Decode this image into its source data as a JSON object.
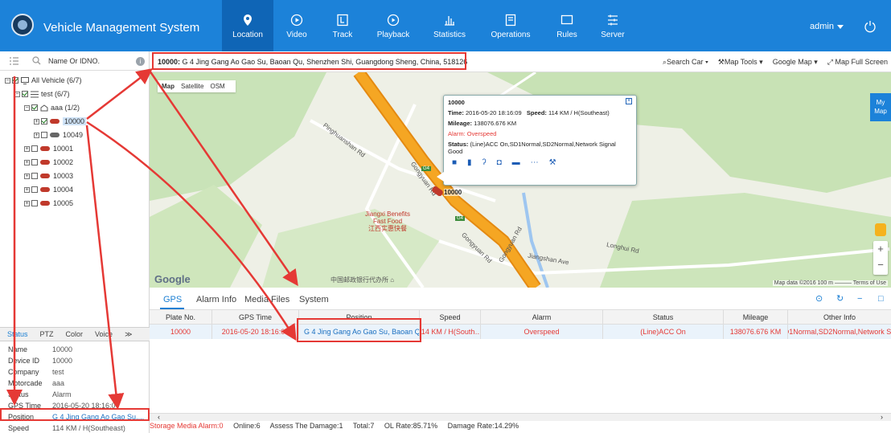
{
  "app": {
    "title": "Vehicle Management System",
    "nav": [
      {
        "label": "Location",
        "icon": "location-icon"
      },
      {
        "label": "Video",
        "icon": "video-icon"
      },
      {
        "label": "Track",
        "icon": "track-icon"
      },
      {
        "label": "Playback",
        "icon": "playback-icon"
      },
      {
        "label": "Statistics",
        "icon": "statistics-icon"
      },
      {
        "label": "Operations",
        "icon": "operations-icon"
      },
      {
        "label": "Rules",
        "icon": "rules-icon"
      },
      {
        "label": "Server",
        "icon": "server-icon"
      }
    ],
    "active_nav": "Location",
    "user": "admin"
  },
  "sidebar": {
    "search_placeholder": "Name Or IDNO.",
    "tree": {
      "all": "All Vehicle  (6/7)",
      "group": "test  (6/7)",
      "subgroup": "aaa  (1/2)",
      "v1": "10000",
      "v2": "10049",
      "v3": "10001",
      "v4": "10002",
      "v5": "10003",
      "v6": "10004",
      "v7": "10005"
    },
    "status_tabs": [
      "Status",
      "PTZ",
      "Color",
      "Voice"
    ],
    "status": {
      "name_k": "Name",
      "name_v": "10000",
      "device_k": "Device ID",
      "device_v": "10000",
      "company_k": "Company",
      "company_v": "test",
      "motorcade_k": "Motorcade",
      "motorcade_v": "aaa",
      "status_k": "Status",
      "status_v": "Alarm",
      "gpstime_k": "GPS Time",
      "gpstime_v": "2016-05-20 18:16:0",
      "position_k": "Position",
      "position_v": "G 4 Jing Gang Ao Gao Su,...",
      "speed_k": "Speed",
      "speed_v": "114 KM / H(Southeast)"
    }
  },
  "address_bar": {
    "id": "10000:",
    "address": "G 4 Jing Gang Ao Gao Su, Baoan Qu, Shenzhen Shi, Guangdong Sheng, China, 518126",
    "tools": [
      "Search Car ▾",
      "Map Tools ▾",
      "Google Map ▾",
      "Map Full Screen"
    ]
  },
  "map": {
    "types": [
      "Map",
      "Satellite",
      "OSM"
    ],
    "logo": "Google",
    "credit": "Map data ©2016   100 m ———   Terms of Use",
    "my_map": "My Map",
    "roads": {
      "pinghuanshan": "Pinghuanshan Rd",
      "gongyuan1": "Gongyuan Rd",
      "gongyuan2": "Gongyuan Rd",
      "gongyuan3": "Gongyuan Rd",
      "jiangshan": "Jiangshan Ave",
      "longhui": "Longhui Rd",
      "post": "中国邮政银行代办所 ⌂"
    },
    "poi": "Jiangxi Benefits\nFast Food\n江西实惠快餐",
    "shields": [
      "G4",
      "G4"
    ],
    "vehicle_label": "10000",
    "popup": {
      "title": "10000",
      "time_label": "Time:",
      "time": "2016-05-20 18:16:09",
      "speed_label": "Speed:",
      "speed": "114 KM / H(Southeast)",
      "mileage_label": "Mileage:",
      "mileage": "138076.676 KM",
      "alarm": "Alarm: Overspeed",
      "status_label": "Status:",
      "status": "(Line)ACC On,SD1Normal,SD2Normal,Network Signal Good"
    }
  },
  "bottom": {
    "tabs": [
      "GPS",
      "Alarm Info",
      "Media Files",
      "System"
    ],
    "columns": [
      "Plate No.",
      "GPS Time",
      "Position",
      "Speed",
      "Alarm",
      "Status",
      "Mileage",
      "Other Info"
    ],
    "row": {
      "plate": "10000",
      "time": "2016-05-20 18:16:09",
      "position": "G 4 Jing Gang Ao Gao Su, Baoan Qu",
      "speed": "114 KM / H(South…",
      "alarm": "Overspeed",
      "status": "(Line)ACC On",
      "mileage": "138076.676 KM",
      "other": "SD1Normal,SD2Normal,Network Si…"
    }
  },
  "footer": {
    "storage": "Storage Media Alarm:0",
    "online": "Online:6",
    "assess": "Assess The Damage:1",
    "total": "Total:7",
    "ol_rate": "OL Rate:85.71%",
    "damage_rate": "Damage Rate:14.29%"
  },
  "colors": {
    "topbar": "#1c82d9",
    "active_nav": "#0f65b6",
    "alert_red": "#e53935",
    "highway_orange": "#f39c12"
  }
}
